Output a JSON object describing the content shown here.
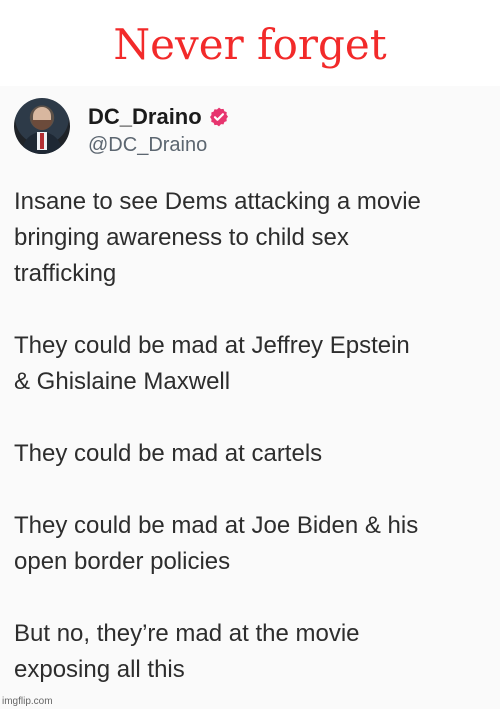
{
  "caption": "Never forget",
  "tweet": {
    "author": {
      "name": "DC_Draino",
      "handle": "@DC_Draino"
    },
    "paragraphs": [
      [
        "Insane to see Dems attacking a movie",
        "bringing awareness to child sex",
        "trafficking"
      ],
      [
        "They could be mad at Jeffrey Epstein",
        "& Ghislaine Maxwell"
      ],
      [
        "They could be mad at cartels"
      ],
      [
        "They could be mad at Joe Biden & his",
        "open border policies"
      ],
      [
        "But no, they’re mad at the movie",
        "exposing all this"
      ]
    ]
  },
  "watermark": "imgflip.com",
  "colors": {
    "caption": "#f22a2a",
    "verified_badge": "#e7356f"
  },
  "icons": {
    "verified": "verified-badge-icon"
  }
}
